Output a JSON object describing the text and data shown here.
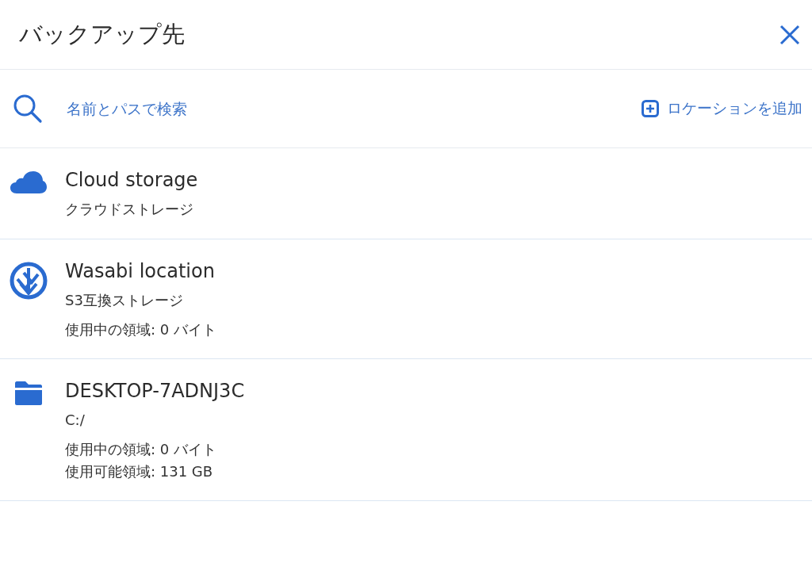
{
  "header": {
    "title": "バックアップ先"
  },
  "search": {
    "placeholder": "名前とパスで検索"
  },
  "add_location": {
    "label": "ロケーションを追加"
  },
  "locations": [
    {
      "kind": "cloud",
      "name": "Cloud storage",
      "subtitle": "クラウドストレージ"
    },
    {
      "kind": "wasabi",
      "name": "Wasabi location",
      "subtitle": "S3互換ストレージ",
      "details": [
        "使用中の領域: 0 バイト"
      ]
    },
    {
      "kind": "folder",
      "name": "DESKTOP-7ADNJ3C",
      "subtitle": "C:/",
      "details": [
        "使用中の領域: 0 バイト",
        "使用可能領域: 131 GB"
      ]
    }
  ]
}
